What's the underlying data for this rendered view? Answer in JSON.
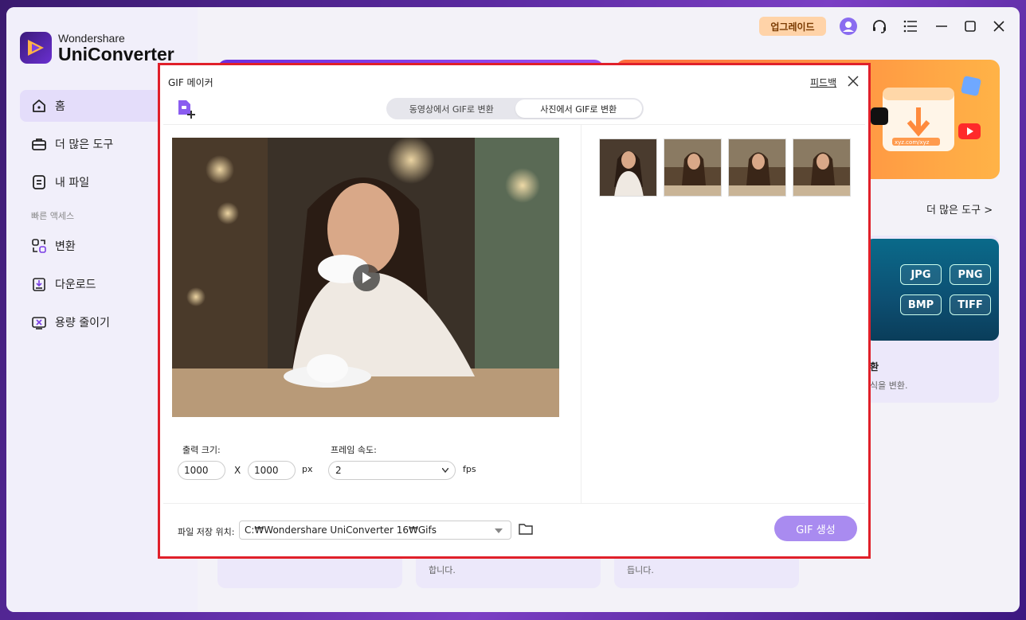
{
  "app": {
    "brand": "Wondershare",
    "product": "UniConverter"
  },
  "topbar": {
    "upgrade_label": "업그레이드"
  },
  "sidebar": {
    "items": [
      {
        "label": "홈",
        "icon": "home-icon"
      },
      {
        "label": "더 많은 도구",
        "icon": "toolbox-icon"
      },
      {
        "label": "내 파일",
        "icon": "file-icon"
      }
    ],
    "quick_access_label": "빠른 액세스",
    "quick_items": [
      {
        "label": "변환",
        "icon": "convert-icon"
      },
      {
        "label": "다운로드",
        "icon": "download-icon"
      },
      {
        "label": "용량 줄이기",
        "icon": "compress-icon"
      }
    ]
  },
  "background": {
    "more_tools": "더 많은 도구 >",
    "formats": [
      "JPG",
      "PNG",
      "BMP",
      "TIFF"
    ],
    "convert_card_title": "환",
    "convert_card_desc": "식을 변환.",
    "banner_text": "xyz.com/xyz",
    "bottom_card_1": "",
    "bottom_card_2": "합니다.",
    "bottom_card_3": "듭니다."
  },
  "dialog": {
    "title": "GIF 메이커",
    "feedback": "피드백",
    "tabs": [
      {
        "label": "동영상에서 GIF로 변환",
        "active": false
      },
      {
        "label": "사진에서 GIF로 변환",
        "active": true
      }
    ],
    "output_size_label": "출력 크기:",
    "width_value": "1000",
    "height_value": "1000",
    "x_sep": "X",
    "px_unit": "px",
    "frame_rate_label": "프레임 속도:",
    "frame_rate_value": "2",
    "fps_unit": "fps",
    "save_location_label": "파일 저장 위치:",
    "save_path": "C:₩Wondershare UniConverter 16₩Gifs",
    "create_button": "GIF 생성",
    "thumbnail_count": 4
  },
  "colors": {
    "accent": "#a98bf0",
    "sidebar_active": "#e4ddfa",
    "upgrade_bg": "#ffd3a8",
    "highlight_border": "#e0202a"
  }
}
